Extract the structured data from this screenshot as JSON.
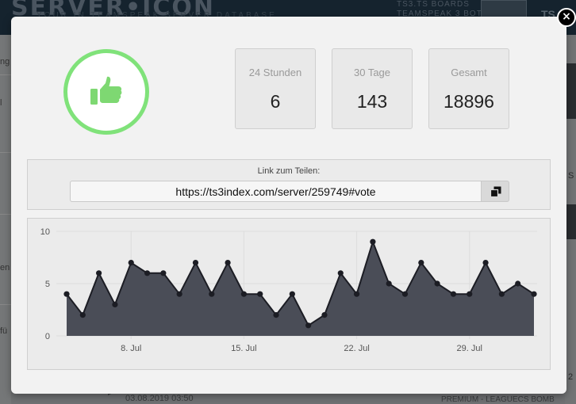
{
  "background": {
    "logo_text": "SERVER•ICON",
    "tagline": "YOUR IN TEAMSPEAK SERVER DATABASE",
    "header_right_line1": "TS3.TS BOARDS",
    "header_right_line2": "TEAMSPEAK 3 BOT",
    "header_ts": "TS",
    "left_fragments": [
      "ng",
      "l",
      "en",
      "fü"
    ],
    "bottom_date": "03.08.2019 03:50",
    "bottom_right": "PREMIUM - LEAGUECS BOMB",
    "right_fragments": [
      "S",
      "2"
    ]
  },
  "modal": {
    "close_label": "×",
    "stats": [
      {
        "label": "24 Stunden",
        "value": "6"
      },
      {
        "label": "30 Tage",
        "value": "143"
      },
      {
        "label": "Gesamt",
        "value": "18896"
      }
    ],
    "share": {
      "label": "Link zum Teilen:",
      "url": "https://ts3index.com/server/259749#vote"
    }
  },
  "colors": {
    "vote_ring": "#80e27a",
    "vote_icon": "#7ed872",
    "chart_area": "#4a4d57",
    "chart_line": "#1c1d24",
    "chart_point": "#1c1d24"
  },
  "chart_data": {
    "type": "area",
    "x_start": "2019-07-04",
    "x_end": "2019-08-02",
    "values": [
      4,
      2,
      6,
      3,
      7,
      6,
      6,
      4,
      7,
      4,
      7,
      4,
      4,
      2,
      4,
      1,
      2,
      6,
      4,
      9,
      5,
      4,
      7,
      5,
      4,
      4,
      7,
      4,
      5,
      4
    ],
    "ylim": [
      0,
      10
    ],
    "yticks": [
      "0",
      "5",
      "10"
    ],
    "xticks": [
      {
        "index": 4,
        "label": "8. Jul"
      },
      {
        "index": 11,
        "label": "15. Jul"
      },
      {
        "index": 18,
        "label": "22. Jul"
      },
      {
        "index": 25,
        "label": "29. Jul"
      }
    ],
    "grid": true,
    "legend": "none"
  }
}
